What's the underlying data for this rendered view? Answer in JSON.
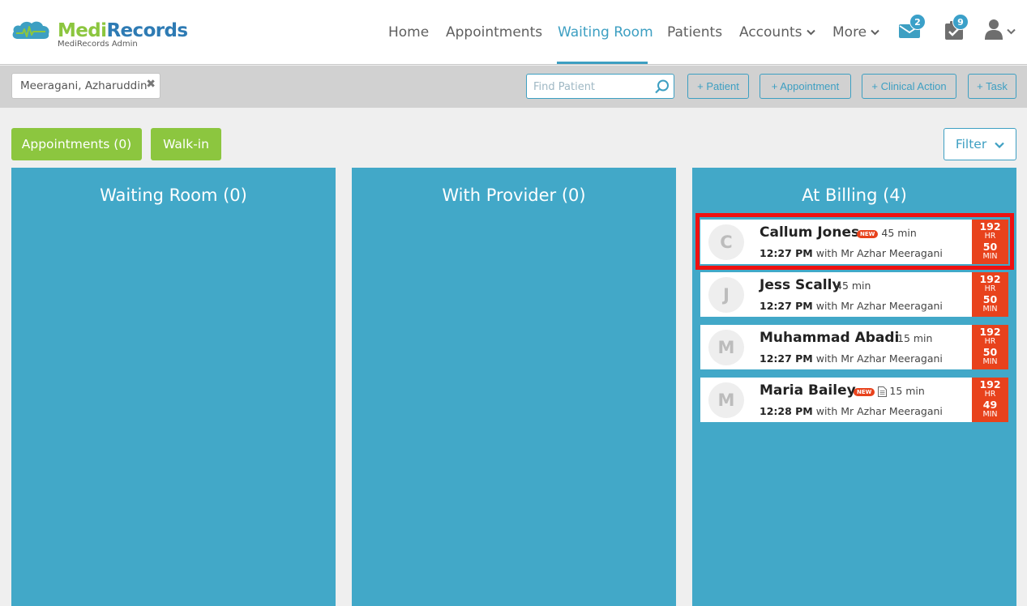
{
  "app": {
    "brand_part1": "Medi",
    "brand_part2": "Records",
    "brand_sub": "MediRecords Admin"
  },
  "nav": {
    "items": [
      {
        "label": "Home"
      },
      {
        "label": "Appointments"
      },
      {
        "label": "Waiting Room",
        "active": true
      },
      {
        "label": "Patients"
      },
      {
        "label": "Accounts",
        "dropdown": true
      },
      {
        "label": "More",
        "dropdown": true
      }
    ],
    "messages_badge": "2",
    "tasks_badge": "9"
  },
  "toolbar": {
    "selected_provider": "Meeragani, Azharuddin",
    "search_placeholder": "Find Patient",
    "buttons": [
      "+ Patient",
      "+ Appointment",
      "+ Clinical Action",
      "+ Task"
    ]
  },
  "actions": {
    "appointments_label": "Appointments (0)",
    "walkin_label": "Walk-in",
    "filter_label": "Filter"
  },
  "columns": [
    {
      "title": "Waiting Room (0)"
    },
    {
      "title": "With Provider (0)"
    },
    {
      "title": "At Billing (4)"
    }
  ],
  "patients": [
    {
      "initial": "C",
      "name": "Callum Jones",
      "new_badge": "NEW",
      "has_doc": false,
      "duration": "45 min",
      "time": "12:27 PM",
      "provider": "with Mr Azhar Meeragani",
      "timer_hr": "192",
      "timer_hr_unit": "HR",
      "timer_min": "50",
      "timer_min_unit": "MIN"
    },
    {
      "initial": "J",
      "name": "Jess Scally",
      "new_badge": "",
      "has_doc": false,
      "duration": "45 min",
      "time": "12:27 PM",
      "provider": "with Mr Azhar Meeragani",
      "timer_hr": "192",
      "timer_hr_unit": "HR",
      "timer_min": "50",
      "timer_min_unit": "MIN"
    },
    {
      "initial": "M",
      "name": "Muhammad Abadi",
      "new_badge": "",
      "has_doc": false,
      "duration": "15 min",
      "time": "12:27 PM",
      "provider": "with Mr Azhar Meeragani",
      "timer_hr": "192",
      "timer_hr_unit": "HR",
      "timer_min": "50",
      "timer_min_unit": "MIN"
    },
    {
      "initial": "M",
      "name": "Maria Bailey",
      "new_badge": "NEW",
      "has_doc": true,
      "duration": "15 min",
      "time": "12:28 PM",
      "provider": "with Mr Azhar Meeragani",
      "timer_hr": "192",
      "timer_hr_unit": "HR",
      "timer_min": "49",
      "timer_min_unit": "MIN"
    }
  ],
  "colors": {
    "brand_green": "#8cc63f",
    "brand_blue": "#2e7bb4",
    "accent": "#3d9fc2",
    "column_bg": "#42a8c8",
    "timer_red": "#e8421c",
    "highlight_red": "#ee1111"
  }
}
